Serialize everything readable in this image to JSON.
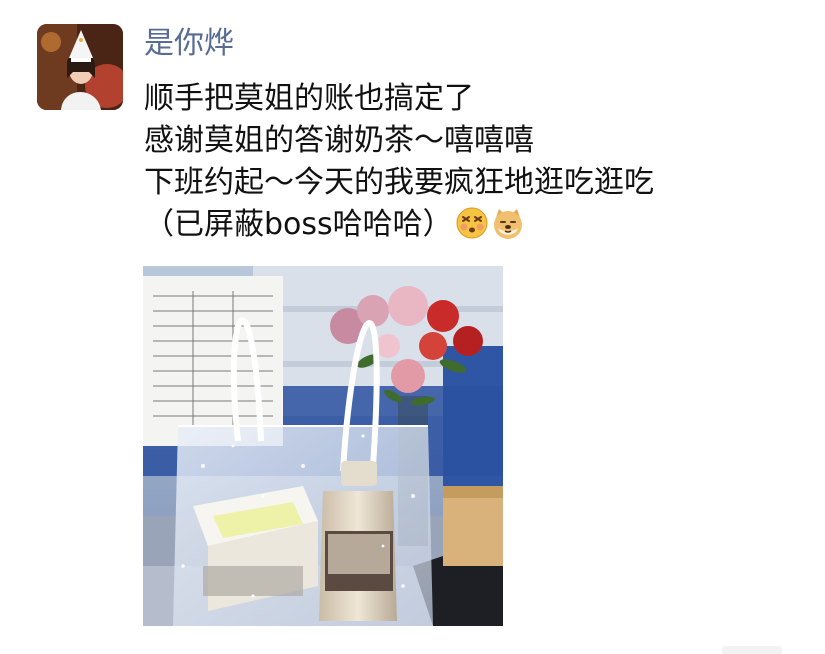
{
  "post": {
    "username": "是你烨",
    "lines": [
      "顺手把莫姐的账也搞定了",
      "感谢莫姐的答谢奶茶～嘻嘻嘻",
      "下班约起～今天的我要疯狂地逛吃逛吃",
      "（已屏蔽boss哈哈哈）"
    ],
    "emojis": [
      "dizzy-face-emoji",
      "doge-emoji"
    ]
  },
  "colors": {
    "username": "#576b95",
    "text": "#111111",
    "background": "#ffffff"
  }
}
